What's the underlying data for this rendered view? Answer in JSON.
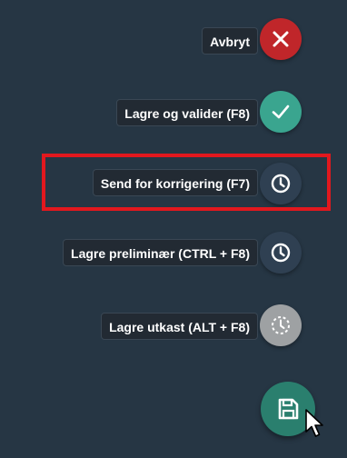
{
  "actions": [
    {
      "label": "Avbryt",
      "icon": "close-icon",
      "color": "#c0262a"
    },
    {
      "label": "Lagre og valider (F8)",
      "icon": "check-icon",
      "color": "#3aa58f"
    },
    {
      "label": "Send for korrigering (F7)",
      "icon": "clock-icon",
      "color": "#2f4052"
    },
    {
      "label": "Lagre preliminær (CTRL + F8)",
      "icon": "clock-icon",
      "color": "#2f4052"
    },
    {
      "label": "Lagre utkast (ALT + F8)",
      "icon": "clock-dashed-icon",
      "color": "#9ea1a3"
    }
  ],
  "main_button": {
    "icon": "save-icon",
    "color": "#2a7f6e"
  },
  "highlight": {
    "color": "#e2181e",
    "target": "Send for korrigering (F7)"
  }
}
